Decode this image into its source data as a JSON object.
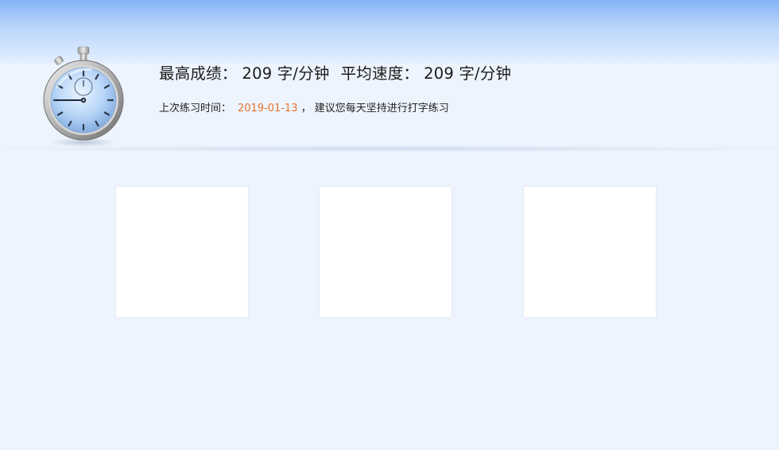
{
  "header": {
    "best_label": "最高成绩：",
    "best_value": "209 字/分钟",
    "avg_label": "平均速度：",
    "avg_value": "209 字/分钟",
    "last_practice_label": "上次练习时间：",
    "last_practice_date": "2019-01-13",
    "suggestion": "， 建议您每天坚持进行打字练习",
    "icon": "stopwatch-icon",
    "date_color": "#e8712c"
  },
  "cards": [
    {
      "id": "card-1"
    },
    {
      "id": "card-2"
    },
    {
      "id": "card-3"
    }
  ],
  "colors": {
    "background": "#edf4fe",
    "top_gradient": "#86b4f6",
    "card": "#ffffff"
  }
}
